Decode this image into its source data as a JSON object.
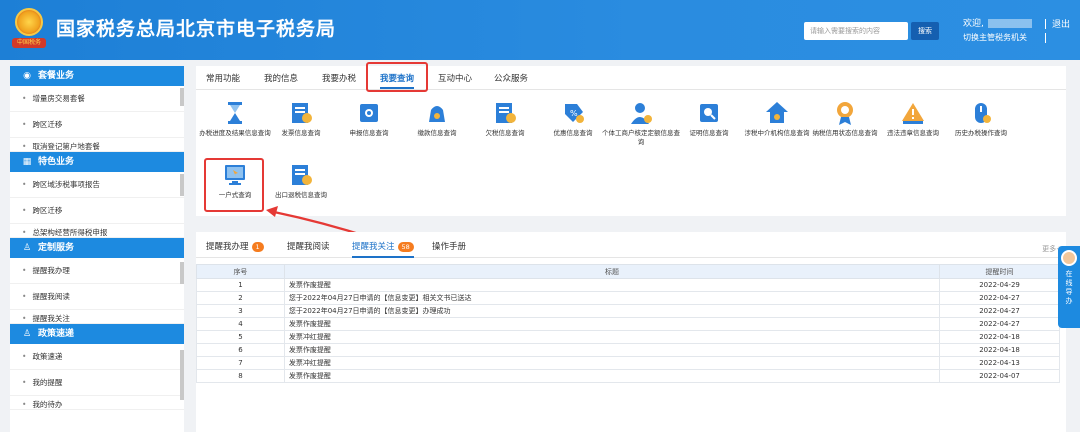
{
  "header": {
    "title": "国家税务总局北京市电子税务局",
    "emblem_text": "中国税务",
    "search_placeholder": "请输入需要搜索的内容",
    "search_button": "搜索",
    "welcome": "欢迎,",
    "switch_org": "切换主管税务机关",
    "logout": "退出"
  },
  "sidebar": {
    "sections": [
      {
        "title": "套餐业务",
        "icon": "package-icon",
        "items": [
          "增量房交易套餐",
          "跨区迁移",
          "取消登记第户地套餐"
        ]
      },
      {
        "title": "特色业务",
        "icon": "grid-icon",
        "items": [
          "跨区域涉税事项报告",
          "跨区迁移",
          "总架构经营所得税申报"
        ]
      },
      {
        "title": "定制服务",
        "icon": "user-icon",
        "items": [
          "提醒我办理",
          "提醒我阅读",
          "提醒我关注"
        ]
      },
      {
        "title": "政策速递",
        "icon": "user-icon",
        "items": [
          "政策速递",
          "我的提醒",
          "我的待办"
        ]
      }
    ]
  },
  "tabs": [
    "常用功能",
    "我的信息",
    "我要办税",
    "我要查询",
    "互动中心",
    "公众服务"
  ],
  "active_tab_index": 3,
  "icons": [
    {
      "label": "办税进度及结果信息查询",
      "icon": "hourglass-icon"
    },
    {
      "label": "发票信息查询",
      "icon": "invoice-icon"
    },
    {
      "label": "申报信息查询",
      "icon": "declare-icon"
    },
    {
      "label": "缴款信息查询",
      "icon": "money-bag-icon"
    },
    {
      "label": "欠税信息查询",
      "icon": "invoice-icon"
    },
    {
      "label": "优惠信息查询",
      "icon": "discount-icon"
    },
    {
      "label": "个体工商户核定定额信息查询",
      "icon": "person-icon"
    },
    {
      "label": "证明信息查询",
      "icon": "certificate-icon"
    },
    {
      "label": "涉税中介机构信息查询",
      "icon": "house-icon"
    },
    {
      "label": "纳税信用状态信息查询",
      "icon": "medal-icon"
    },
    {
      "label": "违法违章信息查询",
      "icon": "warning-icon"
    },
    {
      "label": "历史办税操作查询",
      "icon": "history-icon"
    },
    {
      "label": "一户式查询",
      "icon": "monitor-icon"
    },
    {
      "label": "出口退税信息查询",
      "icon": "invoice-icon"
    }
  ],
  "bottom_tabs": [
    {
      "label": "提醒我办理",
      "badge": "1"
    },
    {
      "label": "提醒我阅读",
      "badge": ""
    },
    {
      "label": "提醒我关注",
      "badge": "58"
    },
    {
      "label": "操作手册",
      "badge": ""
    }
  ],
  "active_bottom_tab": 2,
  "more": "更多+",
  "table": {
    "headers": [
      "序号",
      "标题",
      "提醒时间"
    ],
    "rows": [
      [
        "1",
        "发票作废提醒",
        "2022-04-29"
      ],
      [
        "2",
        "您于2022年04月27日申请的【信息变更】相关文书已送达",
        "2022-04-27"
      ],
      [
        "3",
        "您于2022年04月27日申请的【信息变更】办理成功",
        "2022-04-27"
      ],
      [
        "4",
        "发票作废提醒",
        "2022-04-27"
      ],
      [
        "5",
        "发票冲红提醒",
        "2022-04-18"
      ],
      [
        "6",
        "发票作废提醒",
        "2022-04-18"
      ],
      [
        "7",
        "发票冲红提醒",
        "2022-04-13"
      ],
      [
        "8",
        "发票作废提醒",
        "2022-04-07"
      ]
    ]
  },
  "float_tab": "在线导办"
}
